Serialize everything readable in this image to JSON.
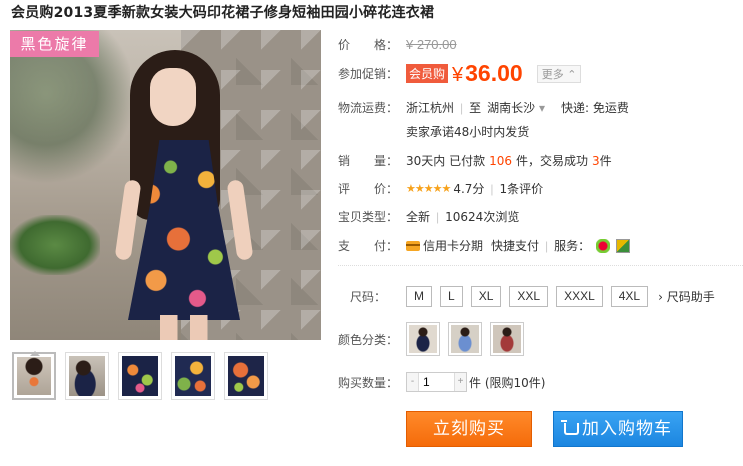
{
  "title": "会员购2013夏季新款女装大码印花裙子修身短袖田园小碎花连衣裙",
  "brand_logo": "黑色旋律",
  "price": {
    "label": "价　　格：",
    "original": "¥ 270.00"
  },
  "promo": {
    "label": "参加促销：",
    "tag": "会员购",
    "currency": "¥",
    "amount": "36.00",
    "more": "更多 ⌃"
  },
  "shipping": {
    "label": "物流运费：",
    "from": "浙江杭州",
    "to_word": "至",
    "to": "湖南长沙",
    "delivery": "快递: 免运费",
    "promise": "卖家承诺48小时内发货"
  },
  "sales": {
    "label": "销　　量：",
    "prefix": "30天内 已付款",
    "paid": "106",
    "mid": "件，交易成功",
    "success": "3",
    "suffix": "件"
  },
  "rating": {
    "label": "评　　价：",
    "stars": "★★★★★",
    "score": "4.7分",
    "reviews": "1条评价"
  },
  "item_type": {
    "label": "宝贝类型：",
    "condition": "全新",
    "views": "10624次浏览"
  },
  "payment": {
    "label": "支　　付：",
    "credit": "信用卡分期",
    "quick": "快捷支付",
    "service_label": "服务："
  },
  "size": {
    "label": "尺码：",
    "options": [
      "M",
      "L",
      "XL",
      "XXL",
      "XXXL",
      "4XL"
    ],
    "helper": "› 尺码助手"
  },
  "color": {
    "label": "颜色分类："
  },
  "quantity": {
    "label": "购买数量：",
    "value": "1",
    "minus": "-",
    "plus": "+",
    "note": "件 (限购10件)"
  },
  "buttons": {
    "buy_now": "立刻购买",
    "add_cart": "加入购物车"
  },
  "colors": {
    "price_red": "#ff4400",
    "buy_orange": "#f56b0a",
    "cart_blue": "#1c86e0"
  }
}
